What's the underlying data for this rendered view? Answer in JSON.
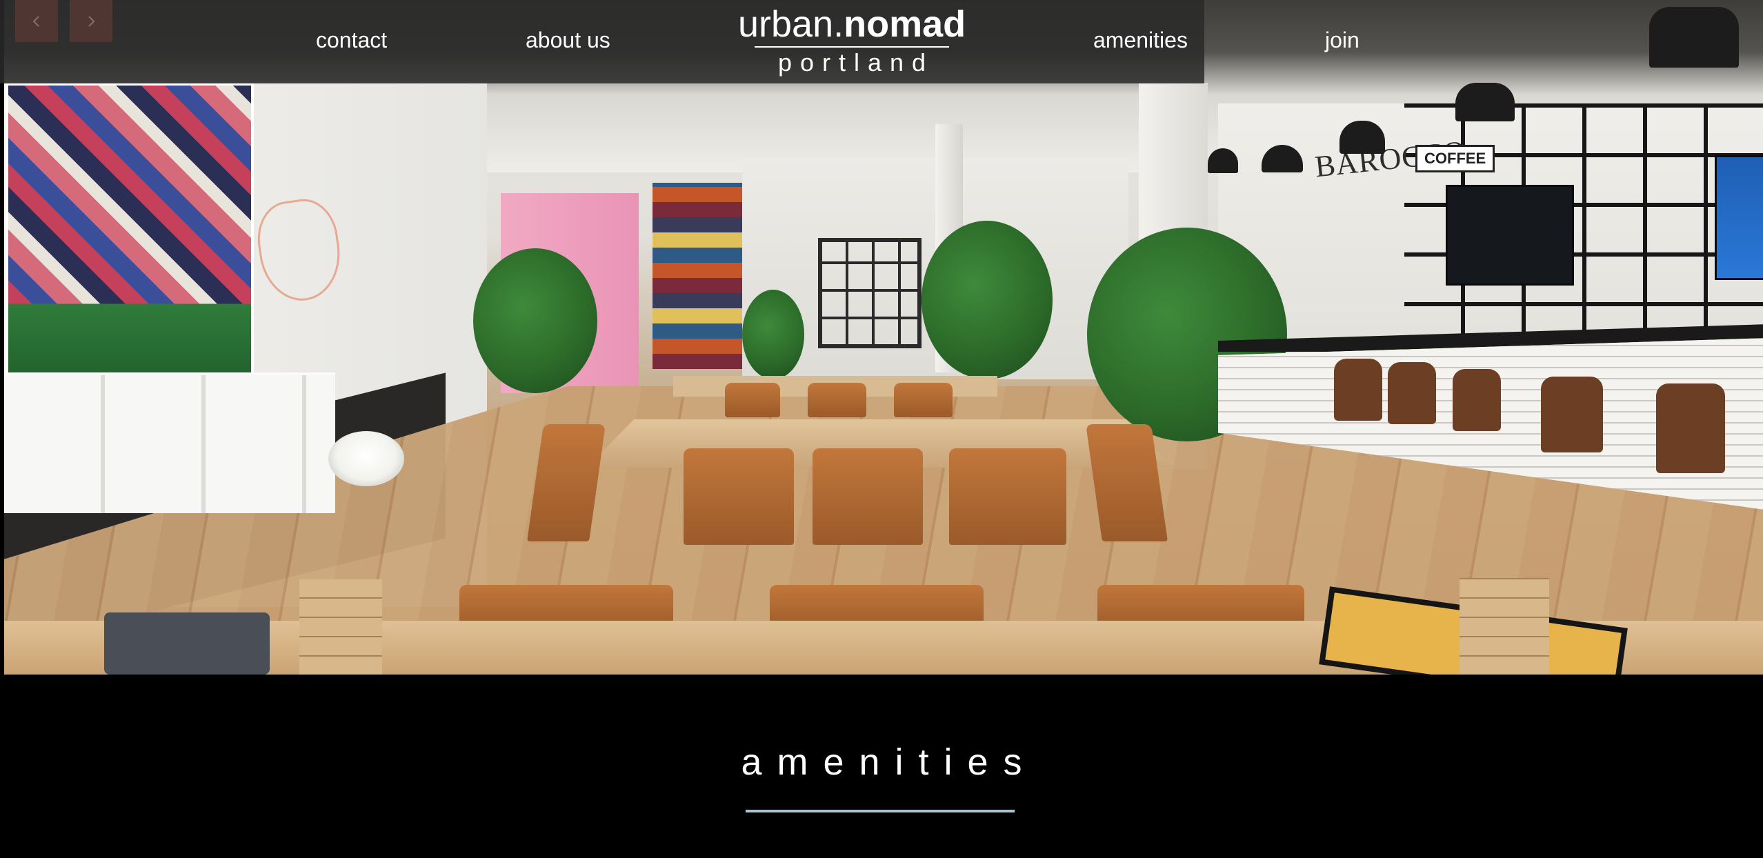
{
  "colors": {
    "nav_background": "#2a2a2a",
    "slider_arrow_bg": "#5a3834",
    "page_background": "#000000",
    "heading_underline": "#a9c4d0",
    "text": "#ffffff"
  },
  "slider": {
    "prev_icon": "chevron-left-icon",
    "next_icon": "chevron-right-icon"
  },
  "nav": {
    "links": [
      {
        "label": "contact"
      },
      {
        "label": "about us"
      },
      {
        "label": "amenities"
      },
      {
        "label": "join"
      }
    ]
  },
  "logo": {
    "prefix": "urban.",
    "emphasis": "nomad",
    "city": "portland"
  },
  "hero": {
    "signage": {
      "bar_name": "BAROCCO",
      "coffee_sign": "COFFEE"
    }
  },
  "section": {
    "title": "amenities"
  }
}
